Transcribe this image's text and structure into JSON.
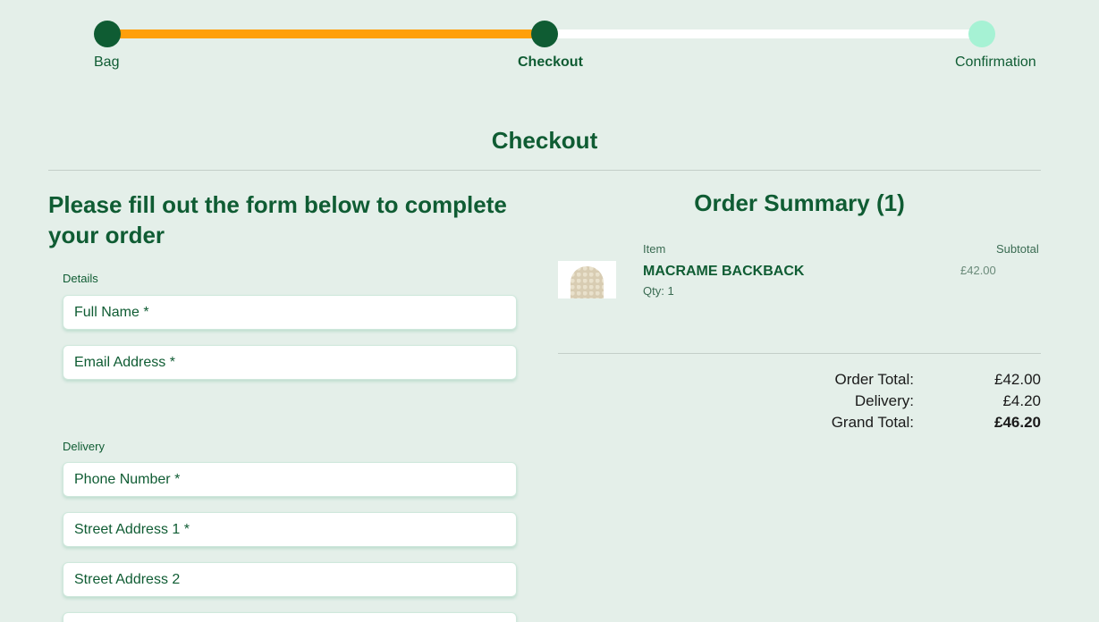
{
  "stepper": {
    "steps": [
      {
        "label": "Bag",
        "state": "done"
      },
      {
        "label": "Checkout",
        "state": "active"
      },
      {
        "label": "Confirmation",
        "state": "todo"
      }
    ],
    "progress_color": "#ff9f0a",
    "done_color": "#0f5c33",
    "todo_color": "#a6f2d4"
  },
  "page_title": "Checkout",
  "form": {
    "heading": "Please fill out the form below to complete your order",
    "details_label": "Details",
    "details_fields": {
      "full_name": "Full Name *",
      "email": "Email Address *"
    },
    "delivery_label": "Delivery",
    "delivery_fields": {
      "phone": "Phone Number *",
      "street1": "Street Address 1 *",
      "street2": "Street Address 2"
    }
  },
  "summary": {
    "title": "Order Summary (1)",
    "col_item": "Item",
    "col_subtotal": "Subtotal",
    "items": [
      {
        "name": "MACRAME BACKBACK",
        "qty": "Qty: 1",
        "price": "£42.00"
      }
    ],
    "order_total_label": "Order Total:",
    "order_total": "£42.00",
    "delivery_label": "Delivery:",
    "delivery": "£4.20",
    "grand_total_label": "Grand Total:",
    "grand_total": "£46.20"
  },
  "colors": {
    "background": "#e4efe9",
    "brand_green": "#0f5c33",
    "accent_orange": "#ff9f0a"
  }
}
